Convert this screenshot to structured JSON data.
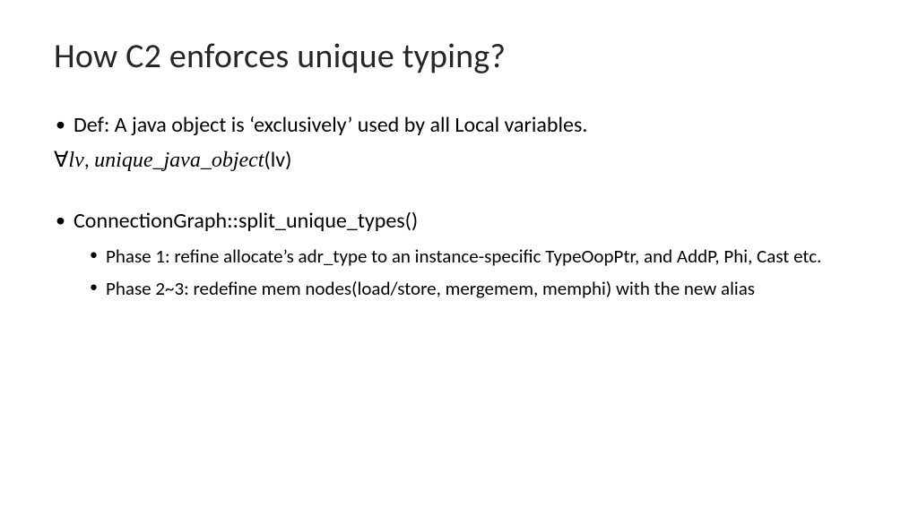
{
  "title": "How C2 enforces unique typing?",
  "bullets": {
    "def": "Def: A java object is ‘exclusively’ used by all Local variables.",
    "formula": {
      "forall": "∀",
      "lv": "lv",
      "comma": ", ",
      "func": "unique_java_object",
      "arg": "(lv)"
    },
    "conn": "ConnectionGraph::split_unique_types()",
    "sub": [
      "Phase 1: refine allocate’s adr_type to an instance-specific TypeOopPtr, and AddP, Phi, Cast etc.",
      "Phase 2~3: redefine mem nodes(load/store, mergemem, memphi) with the new alias"
    ]
  }
}
